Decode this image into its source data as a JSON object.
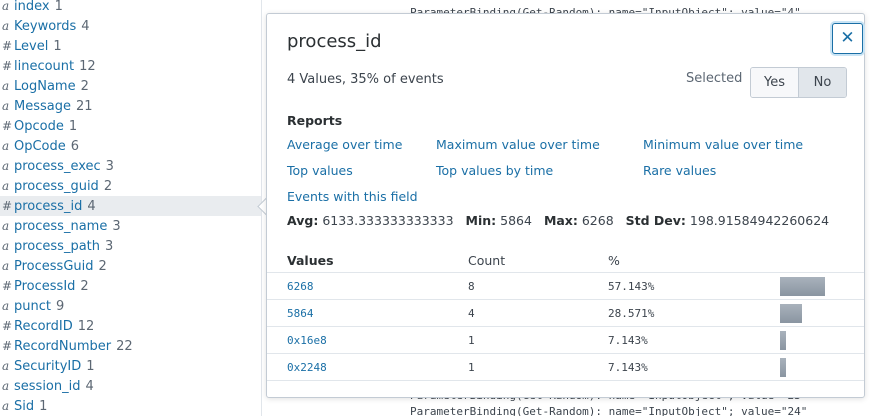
{
  "fields": [
    {
      "type": "a",
      "name": "index",
      "count": "1"
    },
    {
      "type": "a",
      "name": "Keywords",
      "count": "4"
    },
    {
      "type": "#",
      "name": "Level",
      "count": "1"
    },
    {
      "type": "#",
      "name": "linecount",
      "count": "12"
    },
    {
      "type": "a",
      "name": "LogName",
      "count": "2"
    },
    {
      "type": "a",
      "name": "Message",
      "count": "21"
    },
    {
      "type": "#",
      "name": "Opcode",
      "count": "1"
    },
    {
      "type": "a",
      "name": "OpCode",
      "count": "6"
    },
    {
      "type": "a",
      "name": "process_exec",
      "count": "3"
    },
    {
      "type": "a",
      "name": "process_guid",
      "count": "2"
    },
    {
      "type": "#",
      "name": "process_id",
      "count": "4"
    },
    {
      "type": "a",
      "name": "process_name",
      "count": "3"
    },
    {
      "type": "a",
      "name": "process_path",
      "count": "3"
    },
    {
      "type": "a",
      "name": "ProcessGuid",
      "count": "2"
    },
    {
      "type": "#",
      "name": "ProcessId",
      "count": "2"
    },
    {
      "type": "a",
      "name": "punct",
      "count": "9"
    },
    {
      "type": "#",
      "name": "RecordID",
      "count": "12"
    },
    {
      "type": "#",
      "name": "RecordNumber",
      "count": "22"
    },
    {
      "type": "a",
      "name": "SecurityID",
      "count": "1"
    },
    {
      "type": "a",
      "name": "session_id",
      "count": "4"
    },
    {
      "type": "a",
      "name": "Sid",
      "count": "1"
    }
  ],
  "background": {
    "line_top": "ParameterBinding(Get-Random): name=\"InputObject\"; value=\"4\"",
    "line_bottom_1": "ParameterBinding(Get-Random): name=\"InputObject\"; value=\"23\"",
    "line_bottom_2": "ParameterBinding(Get-Random): name=\"InputObject\"; value=\"24\""
  },
  "popover": {
    "title": "process_id",
    "close_glyph": "✕",
    "summary": "4 Values, 35% of events",
    "selected_label": "Selected",
    "yes_label": "Yes",
    "no_label": "No",
    "selected_value": "No",
    "reports_title": "Reports",
    "reports": {
      "average": "Average over time",
      "maximum": "Maximum value over time",
      "minimum": "Minimum value over time",
      "top_values": "Top values",
      "top_values_time": "Top values by time",
      "rare_values": "Rare values",
      "events_with_field": "Events with this field"
    },
    "stats": {
      "avg_label": "Avg:",
      "avg": "6133.333333333333",
      "min_label": "Min:",
      "min": "5864",
      "max_label": "Max:",
      "max": "6268",
      "std_label": "Std Dev:",
      "std": "198.91584942260624"
    },
    "columns": {
      "values": "Values",
      "count": "Count",
      "percent": "%"
    },
    "rows": [
      {
        "value": "6268",
        "count": "8",
        "percent": "57.143%",
        "fraction": 0.57143
      },
      {
        "value": "5864",
        "count": "4",
        "percent": "28.571%",
        "fraction": 0.28571
      },
      {
        "value": "0x16e8",
        "count": "1",
        "percent": "7.143%",
        "fraction": 0.07143
      },
      {
        "value": "0x2248",
        "count": "1",
        "percent": "7.143%",
        "fraction": 0.07143
      }
    ]
  }
}
